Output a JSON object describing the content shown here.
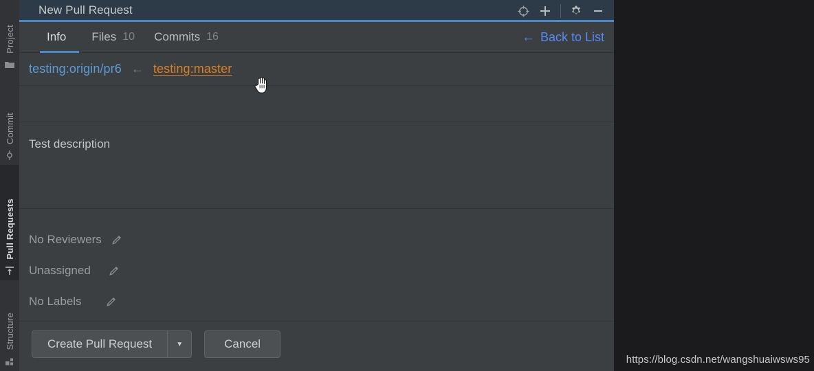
{
  "toolstrip": {
    "items": [
      {
        "label": "Project",
        "icon": "folder-icon",
        "active": false
      },
      {
        "label": "Commit",
        "icon": "commit-node-icon",
        "active": false
      },
      {
        "label": "Pull Requests",
        "icon": "pull-request-icon",
        "active": true
      },
      {
        "label": "Structure",
        "icon": "structure-blocks-icon",
        "active": false
      }
    ]
  },
  "titlebar": {
    "title": "New Pull Request",
    "actions": [
      {
        "name": "locate-icon",
        "glyph": "crosshair"
      },
      {
        "name": "add-icon",
        "glyph": "plus"
      },
      {
        "name": "settings-icon",
        "glyph": "gear"
      },
      {
        "name": "hide-icon",
        "glyph": "minus"
      }
    ],
    "accent_color": "#4a88c7",
    "background_color": "#2c3b47"
  },
  "tabs": [
    {
      "label": "Info",
      "count": "",
      "active": true
    },
    {
      "label": "Files",
      "count": "10",
      "active": false
    },
    {
      "label": "Commits",
      "count": "16",
      "active": false
    }
  ],
  "back_to_list": {
    "label": "Back to List",
    "arrow": "←",
    "color": "#548af7"
  },
  "branch": {
    "target": "testing:origin/pr6",
    "arrow": "←",
    "source": "testing:master",
    "target_color": "#5b9bd5",
    "source_color": "#d98026"
  },
  "title_field": {
    "value": "",
    "placeholder": ""
  },
  "description": {
    "text": "Test description"
  },
  "meta": [
    {
      "label": "No Reviewers",
      "edit_icon": "pencil-icon"
    },
    {
      "label": "Unassigned",
      "edit_icon": "pencil-icon"
    },
    {
      "label": "No Labels",
      "edit_icon": "pencil-icon"
    }
  ],
  "buttons": {
    "create": "Create Pull Request",
    "create_dropdown_glyph": "▼",
    "cancel": "Cancel"
  },
  "watermark": {
    "text": "https://blog.csdn.net/wangshuaiwsws95"
  }
}
